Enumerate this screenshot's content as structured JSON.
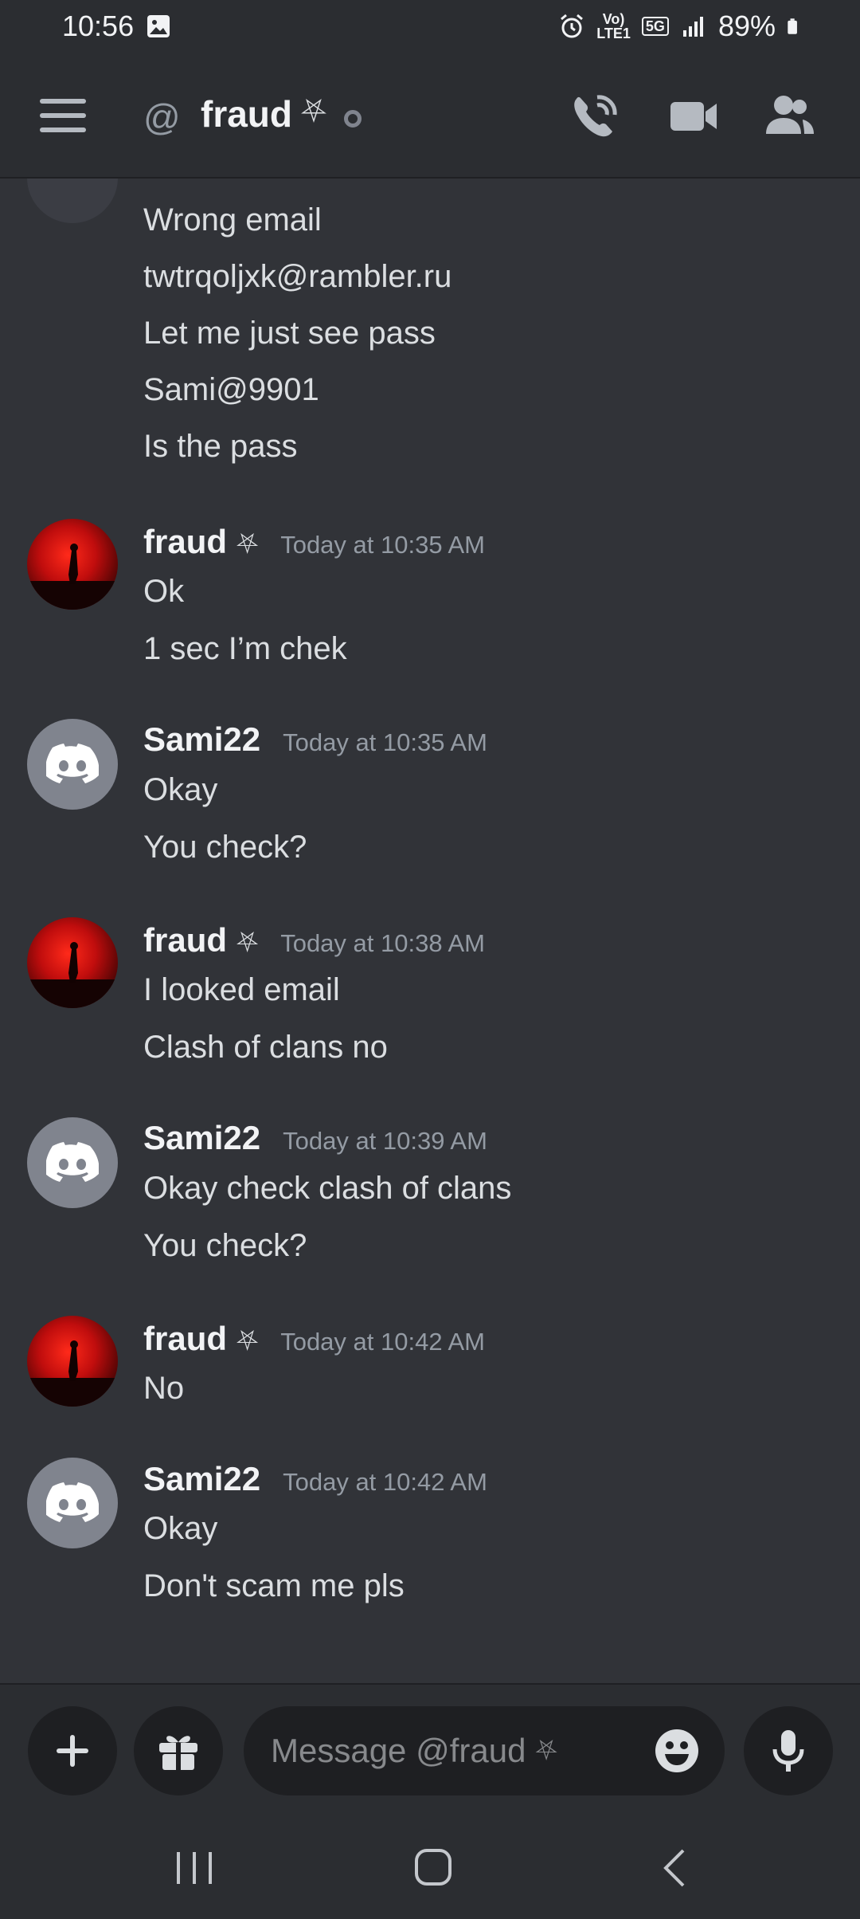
{
  "status_bar": {
    "time": "10:56",
    "volte": "Vo)",
    "lte": "LTE1",
    "network": "5G",
    "battery": "89%"
  },
  "header": {
    "channel_prefix": "@",
    "title": "fraud",
    "title_glyph": "⛧"
  },
  "messages": {
    "continuation_lines": [
      "Wrong email",
      "twtrqoljxk@rambler.ru",
      "Let me just see pass",
      "Sami@9901",
      "Is the pass"
    ],
    "groups": [
      {
        "author": "fraud",
        "glyph": "⛧",
        "time": "Today at 10:35 AM",
        "lines": [
          "Ok",
          "1 sec I’m chek"
        ]
      },
      {
        "author": "Sami22",
        "glyph": "",
        "time": "Today at 10:35 AM",
        "lines": [
          "Okay",
          "You check?"
        ]
      },
      {
        "author": "fraud",
        "glyph": "⛧",
        "time": "Today at 10:38 AM",
        "lines": [
          "I looked email",
          "Clash of clans no"
        ]
      },
      {
        "author": "Sami22",
        "glyph": "",
        "time": "Today at 10:39 AM",
        "lines": [
          "Okay check clash of clans",
          "You check?"
        ]
      },
      {
        "author": "fraud",
        "glyph": "⛧",
        "time": "Today at 10:42 AM",
        "lines": [
          "No"
        ]
      },
      {
        "author": "Sami22",
        "glyph": "",
        "time": "Today at 10:42 AM",
        "lines": [
          "Okay",
          "Don't scam me pls"
        ]
      }
    ]
  },
  "composer": {
    "placeholder": "Message @fraud",
    "placeholder_glyph": "⛧"
  },
  "colors": {
    "background": "#313338",
    "header": "#2b2d31",
    "input": "#1e1f22",
    "muted": "#949ba4"
  }
}
